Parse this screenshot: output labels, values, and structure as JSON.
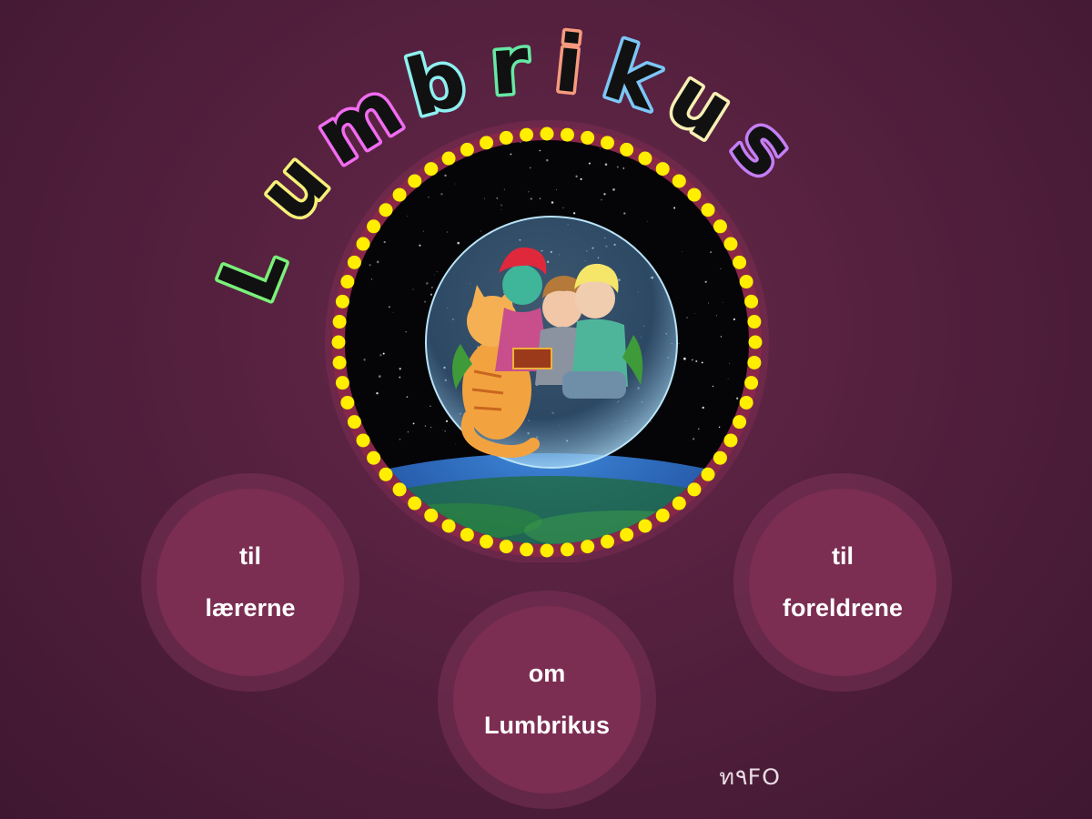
{
  "title": {
    "letters": [
      {
        "char": "L",
        "color": "#7af07a"
      },
      {
        "char": "u",
        "color": "#f6f07a"
      },
      {
        "char": "m",
        "color": "#f06cf0"
      },
      {
        "char": "b",
        "color": "#8ef0f0"
      },
      {
        "char": "r",
        "color": "#66e8a4"
      },
      {
        "char": "i",
        "color": "#f79a7e"
      },
      {
        "char": "k",
        "color": "#7cc6f6"
      },
      {
        "char": "u",
        "color": "#f7efb4"
      },
      {
        "char": "s",
        "color": "#c47ef6"
      }
    ]
  },
  "nav": {
    "teachers": {
      "line1": "til",
      "line2": "lærerne"
    },
    "parents": {
      "line1": "til",
      "line2": "foreldrene"
    },
    "about": {
      "line1": "om",
      "line2": "Lumbrikus"
    }
  },
  "logo": {
    "text": "ท۹FO",
    "icon": "nafo-logo"
  },
  "colors": {
    "background": "#54203e",
    "button_inner": "#7b2d52",
    "dot": "#ffee00",
    "ring": "#8a2748"
  },
  "illustration": {
    "icon": "space-bubble-characters-illustration"
  }
}
